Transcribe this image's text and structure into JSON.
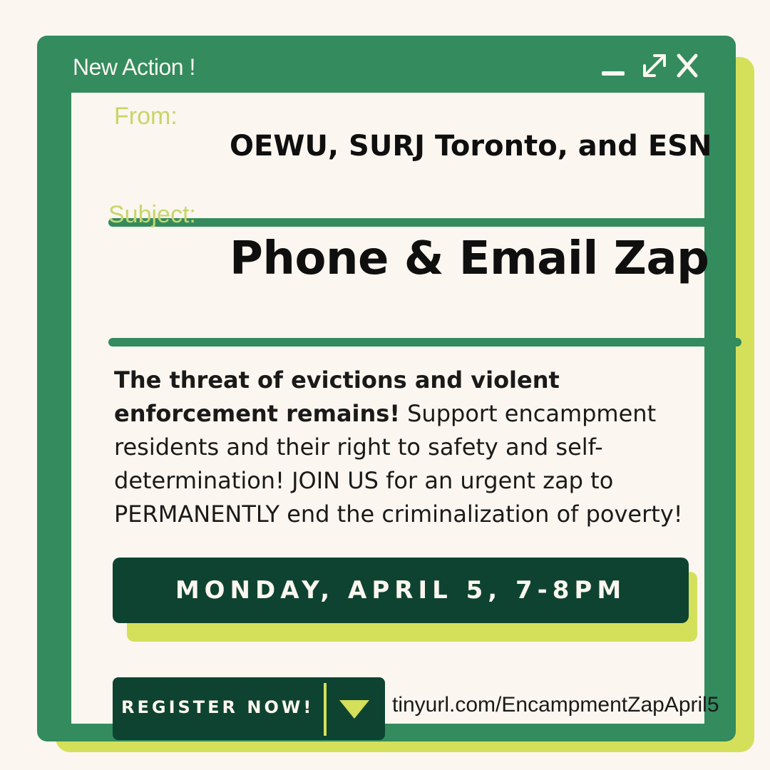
{
  "window": {
    "title": "New Action !",
    "controls": {
      "minimize": "minimize-icon",
      "maximize": "expand-icon",
      "close": "close-icon"
    }
  },
  "email": {
    "from_label": "From:",
    "from_value": "OEWU, SURJ Toronto, and ESN",
    "subject_label": "Subject:",
    "subject_value": "Phone & Email Zap"
  },
  "body": {
    "bold_lead": "The threat of evictions and violent enforcement remains!",
    "text": " Support encampment residents and their right to safety and self-determination! JOIN US for an urgent zap to PERMANENTLY end the criminalization of poverty!"
  },
  "event": {
    "date": "MONDAY, APRIL 5, 7-8PM"
  },
  "cta": {
    "register_label": "REGISTER NOW!",
    "link": "tinyurl.com/EncampmentZapApril5"
  },
  "colors": {
    "frame_green": "#338b5e",
    "accent_yellow": "#d4e05a",
    "dark_green": "#0e4331",
    "background": "#fbf6ef"
  }
}
